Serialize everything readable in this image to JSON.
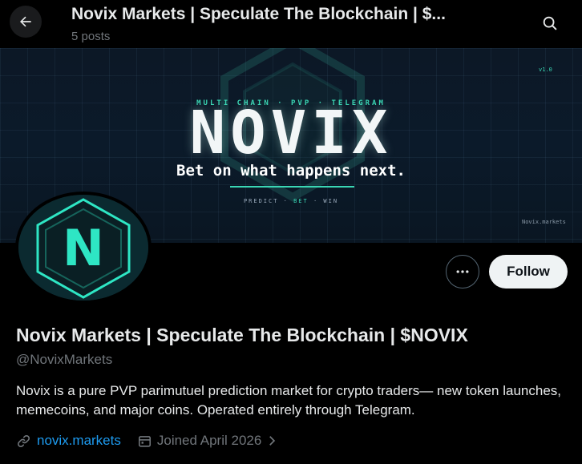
{
  "header": {
    "title": "Novix Markets | Speculate The Blockchain | $...",
    "post_count": "5 posts",
    "back_icon": "arrow-left-icon",
    "search_icon": "search-icon"
  },
  "banner": {
    "kicker": "MULTI CHAIN · PVP · TELEGRAM",
    "headline": "NOVIX",
    "tagline": "Bet on what happens next.",
    "footer_a": "PREDICT · ",
    "footer_b": "BET",
    "footer_c": " · WIN",
    "version": "v1.0",
    "url": "Novix.markets",
    "accent": "#3ad6b4"
  },
  "avatar": {
    "letter": "N",
    "accent": "#2ee6c4"
  },
  "actions": {
    "more_icon": "more-horizontal-icon",
    "follow_label": "Follow"
  },
  "profile": {
    "display_name": "Novix Markets | Speculate The Blockchain | $NOVIX",
    "handle": "@NovixMarkets",
    "bio": "Novix is a pure PVP parimutuel prediction market for crypto traders— new token launches, memecoins, and major coins. Operated entirely  through Telegram.",
    "website": "novix.markets",
    "joined": "Joined April 2026",
    "link_color": "#1d9bf0"
  }
}
